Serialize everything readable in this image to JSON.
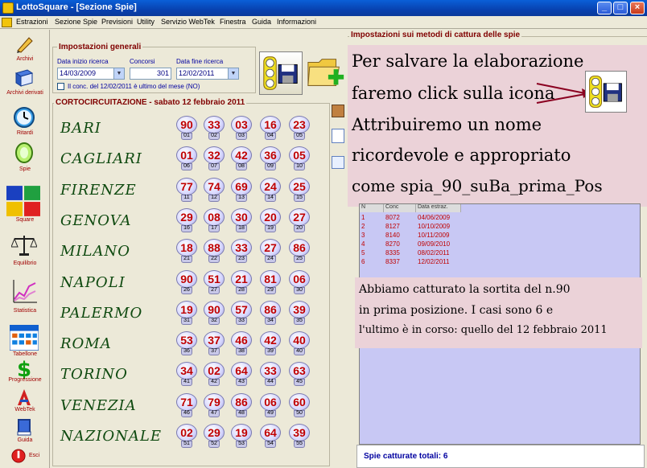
{
  "window": {
    "title": "LottoSquare - [Sezione Spie]",
    "controls": [
      "_",
      "□",
      "×"
    ]
  },
  "menu": {
    "items": [
      "Estrazioni",
      "Sezione Spie",
      "Previsioni",
      "Utility",
      "Servizio WebTek",
      "Finestra",
      "Guida",
      "Informazioni"
    ]
  },
  "sidebar": {
    "tools": [
      {
        "label": "Archivi",
        "icon": "pencil-icon"
      },
      {
        "label": "Archivi derivati",
        "icon": "book-icon"
      },
      {
        "label": "Ritardi",
        "icon": "clock-icon"
      },
      {
        "label": "Spie",
        "icon": "spy-lens-icon"
      },
      {
        "label": "Square",
        "icon": "squares-icon"
      },
      {
        "label": "Equilibrio",
        "icon": "scale-icon"
      },
      {
        "label": "Statistica",
        "icon": "chart-icon"
      },
      {
        "label": "Tabellone",
        "icon": "calendar-icon"
      },
      {
        "label": "Progressione",
        "icon": "dollar-icon"
      },
      {
        "label": "WebTek",
        "icon": "webtek-icon"
      },
      {
        "label": "Guida",
        "icon": "guide-icon"
      },
      {
        "label": "Esci",
        "icon": "exit-icon"
      }
    ]
  },
  "settings": {
    "title": "Impostazioni generali",
    "start_label": "Data inizio ricerca",
    "start_value": "14/03/2009",
    "draws_label": "Concorsi",
    "draws_value": "301",
    "end_label": "Data fine ricerca",
    "end_value": "12/02/2011",
    "checkbox_label": "Il conc. del 12/02/2011 è ultimo del mese (NO)"
  },
  "draw": {
    "title": "CORTOCIRCUITAZIONE - sabato 12 febbraio 2011",
    "rows": [
      {
        "city": "BARI",
        "nums": [
          "90",
          "33",
          "03",
          "16",
          "23"
        ],
        "idx": [
          "01",
          "02",
          "03",
          "04",
          "05"
        ]
      },
      {
        "city": "CAGLIARI",
        "nums": [
          "01",
          "32",
          "42",
          "36",
          "05"
        ],
        "idx": [
          "06",
          "07",
          "08",
          "09",
          "10"
        ]
      },
      {
        "city": "FIRENZE",
        "nums": [
          "77",
          "74",
          "69",
          "24",
          "25"
        ],
        "idx": [
          "11",
          "12",
          "13",
          "14",
          "15"
        ]
      },
      {
        "city": "GENOVA",
        "nums": [
          "29",
          "08",
          "30",
          "20",
          "27"
        ],
        "idx": [
          "16",
          "17",
          "18",
          "19",
          "20"
        ]
      },
      {
        "city": "MILANO",
        "nums": [
          "18",
          "88",
          "33",
          "27",
          "86"
        ],
        "idx": [
          "21",
          "22",
          "23",
          "24",
          "25"
        ]
      },
      {
        "city": "NAPOLI",
        "nums": [
          "90",
          "51",
          "21",
          "81",
          "06"
        ],
        "idx": [
          "26",
          "27",
          "28",
          "29",
          "30"
        ]
      },
      {
        "city": "PALERMO",
        "nums": [
          "19",
          "90",
          "57",
          "86",
          "39"
        ],
        "idx": [
          "31",
          "32",
          "33",
          "34",
          "35"
        ]
      },
      {
        "city": "ROMA",
        "nums": [
          "53",
          "37",
          "46",
          "42",
          "40"
        ],
        "idx": [
          "36",
          "37",
          "38",
          "39",
          "40"
        ]
      },
      {
        "city": "TORINO",
        "nums": [
          "34",
          "02",
          "64",
          "33",
          "63"
        ],
        "idx": [
          "41",
          "42",
          "43",
          "44",
          "45"
        ]
      },
      {
        "city": "VENEZIA",
        "nums": [
          "71",
          "79",
          "86",
          "06",
          "60"
        ],
        "idx": [
          "46",
          "47",
          "48",
          "49",
          "50"
        ]
      },
      {
        "city": "NAZIONALE",
        "nums": [
          "02",
          "29",
          "19",
          "64",
          "39"
        ],
        "idx": [
          "51",
          "52",
          "53",
          "54",
          "55"
        ]
      }
    ]
  },
  "methods": {
    "title": "Impostazioni sui metodi di cattura delle spie"
  },
  "note1": {
    "lines": [
      "Per salvare la elaborazione",
      "faremo click sulla icona",
      "Attribuiremo un nome",
      "ricordevole e appropriato",
      "come spia_90_suBa_prima_Pos"
    ]
  },
  "table": {
    "headers": [
      "N",
      "Conc",
      "Data estraz."
    ],
    "rows": [
      [
        "1",
        "8072",
        "04/06/2009"
      ],
      [
        "2",
        "8127",
        "10/10/2009"
      ],
      [
        "3",
        "8140",
        "10/11/2009"
      ],
      [
        "4",
        "8270",
        "09/09/2010"
      ],
      [
        "5",
        "8335",
        "08/02/2011"
      ],
      [
        "6",
        "8337",
        "12/02/2011"
      ]
    ]
  },
  "note2": {
    "lines": [
      "Abbiamo catturato la sortita del n.90",
      "in prima posizione. I casi sono 6 e",
      "l'ultimo è in corso: quello del 12 febbraio 2011"
    ]
  },
  "status": {
    "text": "Spie catturate totali: 6"
  },
  "colors": {
    "accent_red": "#800000",
    "number_red": "#c00000",
    "note_bg": "#ebd2d8",
    "table_bg": "#c8c8f4"
  }
}
